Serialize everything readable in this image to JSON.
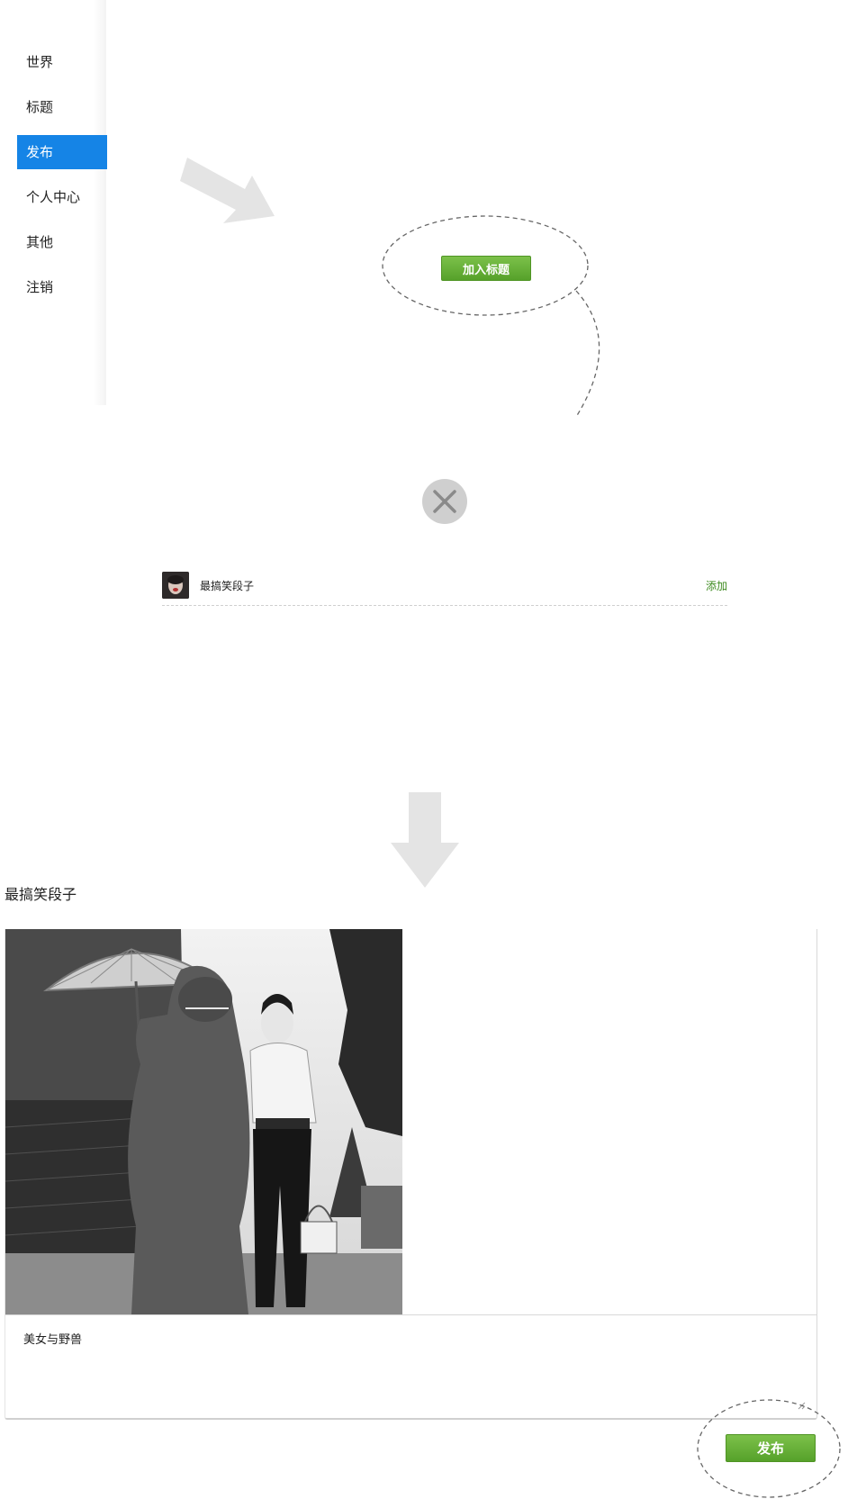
{
  "sidebar": {
    "items": [
      {
        "label": "世界"
      },
      {
        "label": "标题"
      },
      {
        "label": "发布",
        "active": true
      },
      {
        "label": "个人中心"
      },
      {
        "label": "其他"
      },
      {
        "label": "注销"
      }
    ]
  },
  "add_title_button": {
    "label": "加入标题"
  },
  "list": {
    "rows": [
      {
        "title": "最搞笑段子",
        "action": "添加"
      }
    ]
  },
  "post": {
    "title": "最搞笑段子",
    "caption": "美女与野兽",
    "publish_label": "发布"
  },
  "colors": {
    "accent_blue": "#1584e6",
    "button_green": "#6ab23a",
    "link_green": "#3c8a1e",
    "arrow_gray": "#e4e4e4"
  },
  "icons": [
    "close-icon",
    "arrow-right-icon",
    "arrow-down-icon",
    "resize-handle-icon"
  ]
}
